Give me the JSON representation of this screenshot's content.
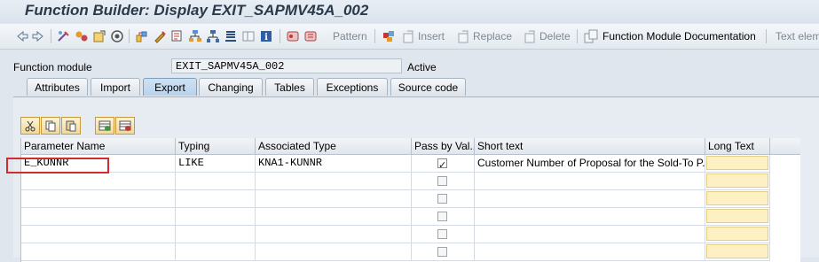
{
  "window": {
    "title": "Function Builder: Display EXIT_SAPMV45A_002"
  },
  "toolbar": {
    "pattern": "Pattern",
    "insert": "Insert",
    "replace": "Replace",
    "delete": "Delete",
    "fm_doc": "Function Module Documentation",
    "text_elements": "Text elem"
  },
  "header": {
    "function_module_label": "Function module",
    "function_module_value": "EXIT_SAPMV45A_002",
    "status": "Active"
  },
  "tabs": [
    {
      "label": "Attributes"
    },
    {
      "label": "Import"
    },
    {
      "label": "Export",
      "active": true
    },
    {
      "label": "Changing"
    },
    {
      "label": "Tables"
    },
    {
      "label": "Exceptions"
    },
    {
      "label": "Source code"
    }
  ],
  "grid": {
    "columns": [
      "Parameter Name",
      "Typing",
      "Associated Type",
      "Pass by Val...",
      "Short text",
      "Long Text"
    ],
    "rows": [
      {
        "name": "E_KUNNR",
        "typing": "LIKE",
        "assoc": "KNA1-KUNNR",
        "pass_by_value": true,
        "short_text": "Customer Number of Proposal for the Sold-To P...",
        "long_text": ""
      },
      {
        "name": "",
        "typing": "",
        "assoc": "",
        "pass_by_value": false,
        "short_text": "",
        "long_text": ""
      },
      {
        "name": "",
        "typing": "",
        "assoc": "",
        "pass_by_value": false,
        "short_text": "",
        "long_text": ""
      },
      {
        "name": "",
        "typing": "",
        "assoc": "",
        "pass_by_value": false,
        "short_text": "",
        "long_text": ""
      },
      {
        "name": "",
        "typing": "",
        "assoc": "",
        "pass_by_value": false,
        "short_text": "",
        "long_text": ""
      },
      {
        "name": "",
        "typing": "",
        "assoc": "",
        "pass_by_value": false,
        "short_text": "",
        "long_text": ""
      }
    ]
  },
  "colors": {
    "highlight": "#d12b2b",
    "active_tab": "#b8d2ec",
    "long_text_field": "#fdf1c4"
  }
}
